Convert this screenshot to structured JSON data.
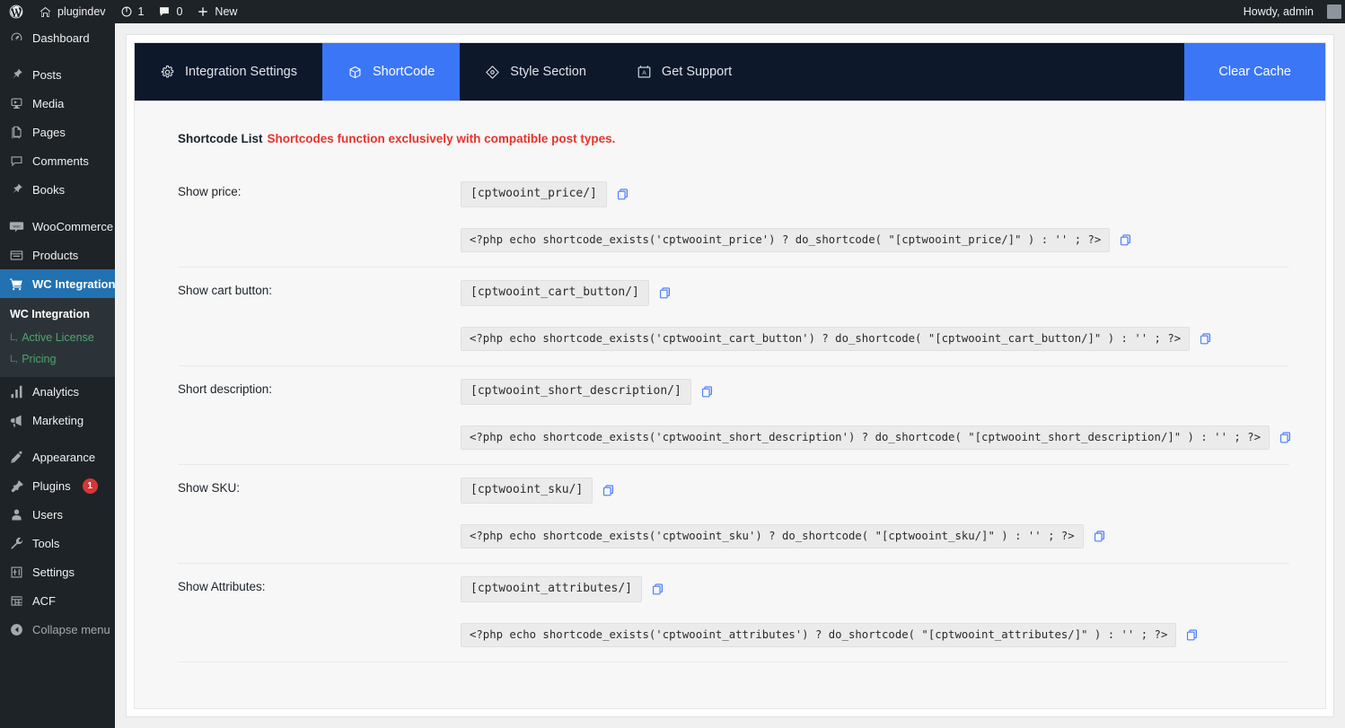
{
  "adminbar": {
    "site_name": "plugindev",
    "updates_count": "1",
    "comments_count": "0",
    "new_label": "New",
    "howdy": "Howdy, admin",
    "icons": {
      "logo": "wordpress-logo-icon",
      "home": "home-icon",
      "updates": "updates-icon",
      "comments": "comments-icon",
      "new": "plus-icon",
      "avatar": "avatar"
    }
  },
  "sidebar": {
    "items": [
      {
        "label": "Dashboard",
        "icon": "dashboard-icon",
        "current": false,
        "sep_after": true
      },
      {
        "label": "Posts",
        "icon": "pin-icon",
        "current": false
      },
      {
        "label": "Media",
        "icon": "media-icon",
        "current": false
      },
      {
        "label": "Pages",
        "icon": "pages-icon",
        "current": false
      },
      {
        "label": "Comments",
        "icon": "comments-icon",
        "current": false
      },
      {
        "label": "Books",
        "icon": "pin-icon",
        "current": false,
        "sep_after": true
      },
      {
        "label": "WooCommerce",
        "icon": "woocommerce-icon",
        "current": false
      },
      {
        "label": "Products",
        "icon": "products-icon",
        "current": false
      },
      {
        "label": "WC Integration",
        "icon": "cart-icon",
        "current": true
      }
    ],
    "submenu": {
      "head": "WC Integration",
      "items": [
        {
          "marker": "L,",
          "label": "Active License"
        },
        {
          "marker": "L,",
          "label": "Pricing"
        }
      ]
    },
    "items_after": [
      {
        "label": "Analytics",
        "icon": "analytics-icon",
        "current": false
      },
      {
        "label": "Marketing",
        "icon": "marketing-icon",
        "current": false,
        "sep_after": true
      },
      {
        "label": "Appearance",
        "icon": "appearance-icon",
        "current": false
      },
      {
        "label": "Plugins",
        "icon": "plugins-icon",
        "current": false,
        "badge": "1"
      },
      {
        "label": "Users",
        "icon": "users-icon",
        "current": false
      },
      {
        "label": "Tools",
        "icon": "tools-icon",
        "current": false
      },
      {
        "label": "Settings",
        "icon": "settings-icon",
        "current": false
      },
      {
        "label": "ACF",
        "icon": "acf-icon",
        "current": false
      },
      {
        "label": "Collapse menu",
        "icon": "collapse-icon",
        "current": false,
        "muted": true
      }
    ]
  },
  "tabs": [
    {
      "label": "Integration Settings",
      "icon": "gear-icon",
      "active": false
    },
    {
      "label": "ShortCode",
      "icon": "cube-icon",
      "active": true
    },
    {
      "label": "Style Section",
      "icon": "diamond-icon",
      "active": false
    },
    {
      "label": "Get Support",
      "icon": "support-card-icon",
      "active": false
    }
  ],
  "clear_cache_label": "Clear Cache",
  "main": {
    "list_title": "Shortcode List",
    "list_warning": "Shortcodes function exclusively with compatible post types.",
    "rows": [
      {
        "label": "Show price:",
        "shortcode": "[cptwooint_price/]",
        "php": "<?php echo shortcode_exists('cptwooint_price') ? do_shortcode( \"[cptwooint_price/]\" ) : '' ; ?>"
      },
      {
        "label": "Show cart button:",
        "shortcode": "[cptwooint_cart_button/]",
        "php": "<?php echo shortcode_exists('cptwooint_cart_button') ? do_shortcode( \"[cptwooint_cart_button/]\" ) : '' ; ?>"
      },
      {
        "label": "Short description:",
        "shortcode": "[cptwooint_short_description/]",
        "php": "<?php echo shortcode_exists('cptwooint_short_description') ? do_shortcode( \"[cptwooint_short_description/]\" ) : '' ; ?>"
      },
      {
        "label": "Show SKU:",
        "shortcode": "[cptwooint_sku/]",
        "php": "<?php echo shortcode_exists('cptwooint_sku') ? do_shortcode( \"[cptwooint_sku/]\" ) : '' ; ?>"
      },
      {
        "label": "Show Attributes:",
        "shortcode": "[cptwooint_attributes/]",
        "php": "<?php echo shortcode_exists('cptwooint_attributes') ? do_shortcode( \"[cptwooint_attributes/]\" ) : '' ; ?>"
      }
    ],
    "copy_icon": "copy-icon"
  },
  "colors": {
    "admin_dark": "#1d2327",
    "menu_current": "#2271b1",
    "tabbar_dark": "#0d182b",
    "accent_blue": "#3b76f6",
    "warning_red": "#e8332a",
    "submenu_green": "#4ca66b",
    "badge_red": "#d63638"
  }
}
